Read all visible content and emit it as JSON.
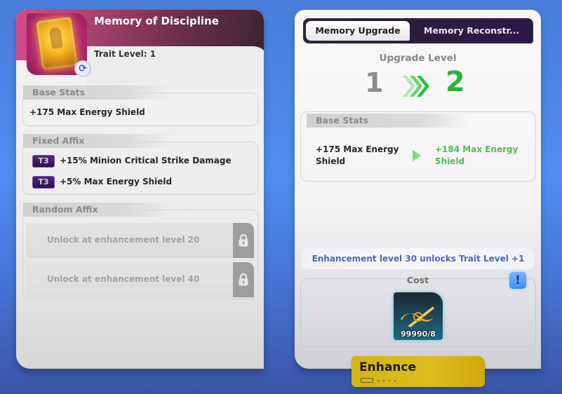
{
  "item": {
    "title": "Memory of Discipline",
    "trait_level_label": "Trait Level: 1",
    "icon": "golden-memory-card-icon",
    "badge_icon": "swap-icon",
    "badge_glyph": "⟳"
  },
  "left_panel": {
    "base_stats": {
      "label": "Base Stats",
      "stat": "+175 Max Energy Shield"
    },
    "fixed_affix": {
      "label": "Fixed Affix",
      "rows": [
        {
          "tier": "T3",
          "text": "+15% Minion Critical Strike Damage"
        },
        {
          "tier": "T3",
          "text": "+5% Max Energy Shield"
        }
      ]
    },
    "random_affix": {
      "label": "Random Affix",
      "rows": [
        {
          "text": "Unlock at enhancement level 20",
          "icon": "lock-icon"
        },
        {
          "text": "Unlock at enhancement level 40",
          "icon": "lock-icon"
        }
      ]
    }
  },
  "right_panel": {
    "tabs": [
      {
        "label": "Memory Upgrade",
        "active": true
      },
      {
        "label": "Memory Reconstr...",
        "active": false
      }
    ],
    "upgrade_level": {
      "label": "Upgrade Level",
      "from": "1",
      "to": "2"
    },
    "base_stats": {
      "label": "Base Stats",
      "from": "+175 Max Energy Shield",
      "to": "+184 Max Energy Shield"
    },
    "unlock_notice": "Enhancement level 30 unlocks Trait Level +1",
    "cost": {
      "label": "Cost",
      "info_glyph": "!",
      "item_icon": "gold-infinity-material-icon",
      "count": "99990/8"
    }
  },
  "enhance_button": {
    "label": "Enhance"
  },
  "colors": {
    "header_pink": "#d74b8a",
    "upgrade_green": "#29b236",
    "stat_green": "#57b65c",
    "notice_blue": "#4a6ab5",
    "tier_purple": "#4a2a7a",
    "enhance_yellow": "#dcbc1f",
    "background_blue": "#4f8ef0"
  }
}
